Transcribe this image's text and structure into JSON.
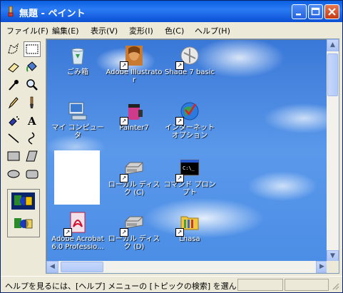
{
  "titlebar": {
    "title": "無題 - ペイント",
    "app_icon": "paint-icon",
    "minimize_icon": "minimize-icon",
    "maximize_icon": "maximize-icon",
    "close_icon": "close-icon"
  },
  "menu": {
    "items": [
      {
        "label": "ファイル(F)"
      },
      {
        "label": "編集(E)"
      },
      {
        "label": "表示(V)"
      },
      {
        "label": "変形(I)"
      },
      {
        "label": "色(C)"
      },
      {
        "label": "ヘルプ(H)"
      }
    ]
  },
  "toolbox": {
    "tools": [
      "free-form-select-icon",
      "select-icon",
      "eraser-icon",
      "fill-icon",
      "pick-color-icon",
      "magnifier-icon",
      "pencil-icon",
      "brush-icon",
      "airbrush-icon",
      "text-icon",
      "line-icon",
      "curve-icon",
      "rectangle-icon",
      "polygon-icon",
      "ellipse-icon",
      "rounded-rectangle-icon"
    ],
    "selected_tool": "select-icon",
    "options": [
      "opaque-selection-icon",
      "transparent-selection-icon"
    ]
  },
  "desktop_icons": [
    {
      "label": "ごみ箱",
      "icon": "recycle-bin-icon",
      "shortcut": false
    },
    {
      "label": "Adobe Illustrator",
      "icon": "illustrator-icon",
      "shortcut": true
    },
    {
      "label": "Shade 7 basic",
      "icon": "shade-icon",
      "shortcut": true
    },
    {
      "label": "マイ コンピュータ",
      "icon": "my-computer-icon",
      "shortcut": false
    },
    {
      "label": "Painter7",
      "icon": "painter-icon",
      "shortcut": true
    },
    {
      "label": "インターネット オプション",
      "icon": "internet-options-icon",
      "shortcut": true
    },
    {
      "label": "ローカル ディスク (C)",
      "icon": "local-disk-icon",
      "shortcut": true
    },
    {
      "label": "コマンド プロンプト",
      "icon": "command-prompt-icon",
      "shortcut": true
    },
    {
      "label": "Adobe Acrobat 6.0 Professio...",
      "icon": "acrobat-icon",
      "shortcut": true
    },
    {
      "label": "ローカル ディスク (D)",
      "icon": "local-disk-icon",
      "shortcut": true
    },
    {
      "label": "Lhasa",
      "icon": "lhasa-folder-icon",
      "shortcut": true
    }
  ],
  "statusbar": {
    "text": "ヘルプを見るには、[ヘルプ] メニューの [トピックの検索] を選んでくださ"
  },
  "colors": {
    "titlebar": "#0a5fe0",
    "sky": "#4c8ee6",
    "face": "#ece9d8"
  }
}
